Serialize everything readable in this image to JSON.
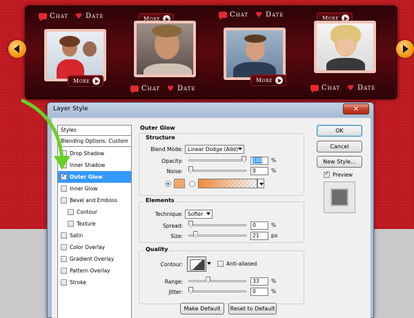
{
  "carousel": {
    "chat_label": "Chat",
    "date_label": "Date",
    "more_label": "More"
  },
  "dialog": {
    "title": "Layer Style",
    "close_glyph": "✕",
    "styles_header": "Styles",
    "blending_header": "Blending Options: Custom",
    "styles_list": [
      {
        "label": "Drop Shadow",
        "checked": false
      },
      {
        "label": "Inner Shadow",
        "checked": false
      },
      {
        "label": "Outer Glow",
        "checked": true
      },
      {
        "label": "Inner Glow",
        "checked": false
      },
      {
        "label": "Bevel and Emboss",
        "checked": false
      },
      {
        "label": "Contour",
        "checked": false
      },
      {
        "label": "Texture",
        "checked": false
      },
      {
        "label": "Satin",
        "checked": false
      },
      {
        "label": "Color Overlay",
        "checked": false
      },
      {
        "label": "Gradient Overlay",
        "checked": false
      },
      {
        "label": "Pattern Overlay",
        "checked": false
      },
      {
        "label": "Stroke",
        "checked": false
      }
    ],
    "panel_title": "Outer Glow",
    "structure": {
      "title": "Structure",
      "blend_mode_label": "Blend Mode:",
      "blend_mode_value": "Linear Dodge (Add)",
      "opacity_label": "Opacity:",
      "opacity_value": "100",
      "opacity_level": 1.0,
      "noise_label": "Noise:",
      "noise_value": "0",
      "noise_level": 0.0,
      "percent": "%",
      "glow_color": "#f3a86a"
    },
    "elements": {
      "title": "Elements",
      "technique_label": "Technique:",
      "technique_value": "Softer",
      "spread_label": "Spread:",
      "spread_value": "0",
      "spread_level": 0.0,
      "size_label": "Size:",
      "size_value": "21",
      "size_level": 0.085,
      "percent": "%",
      "px": "px"
    },
    "quality": {
      "title": "Quality",
      "contour_label": "Contour:",
      "anti_aliased_label": "Anti-aliased",
      "range_label": "Range:",
      "range_value": "33",
      "range_level": 0.33,
      "jitter_label": "Jitter:",
      "jitter_value": "0",
      "jitter_level": 0.0,
      "percent": "%"
    },
    "make_default": "Make Default",
    "reset_default": "Reset to Default",
    "ok": "OK",
    "cancel": "Cancel",
    "new_style": "New Style...",
    "preview_label": "Preview"
  }
}
